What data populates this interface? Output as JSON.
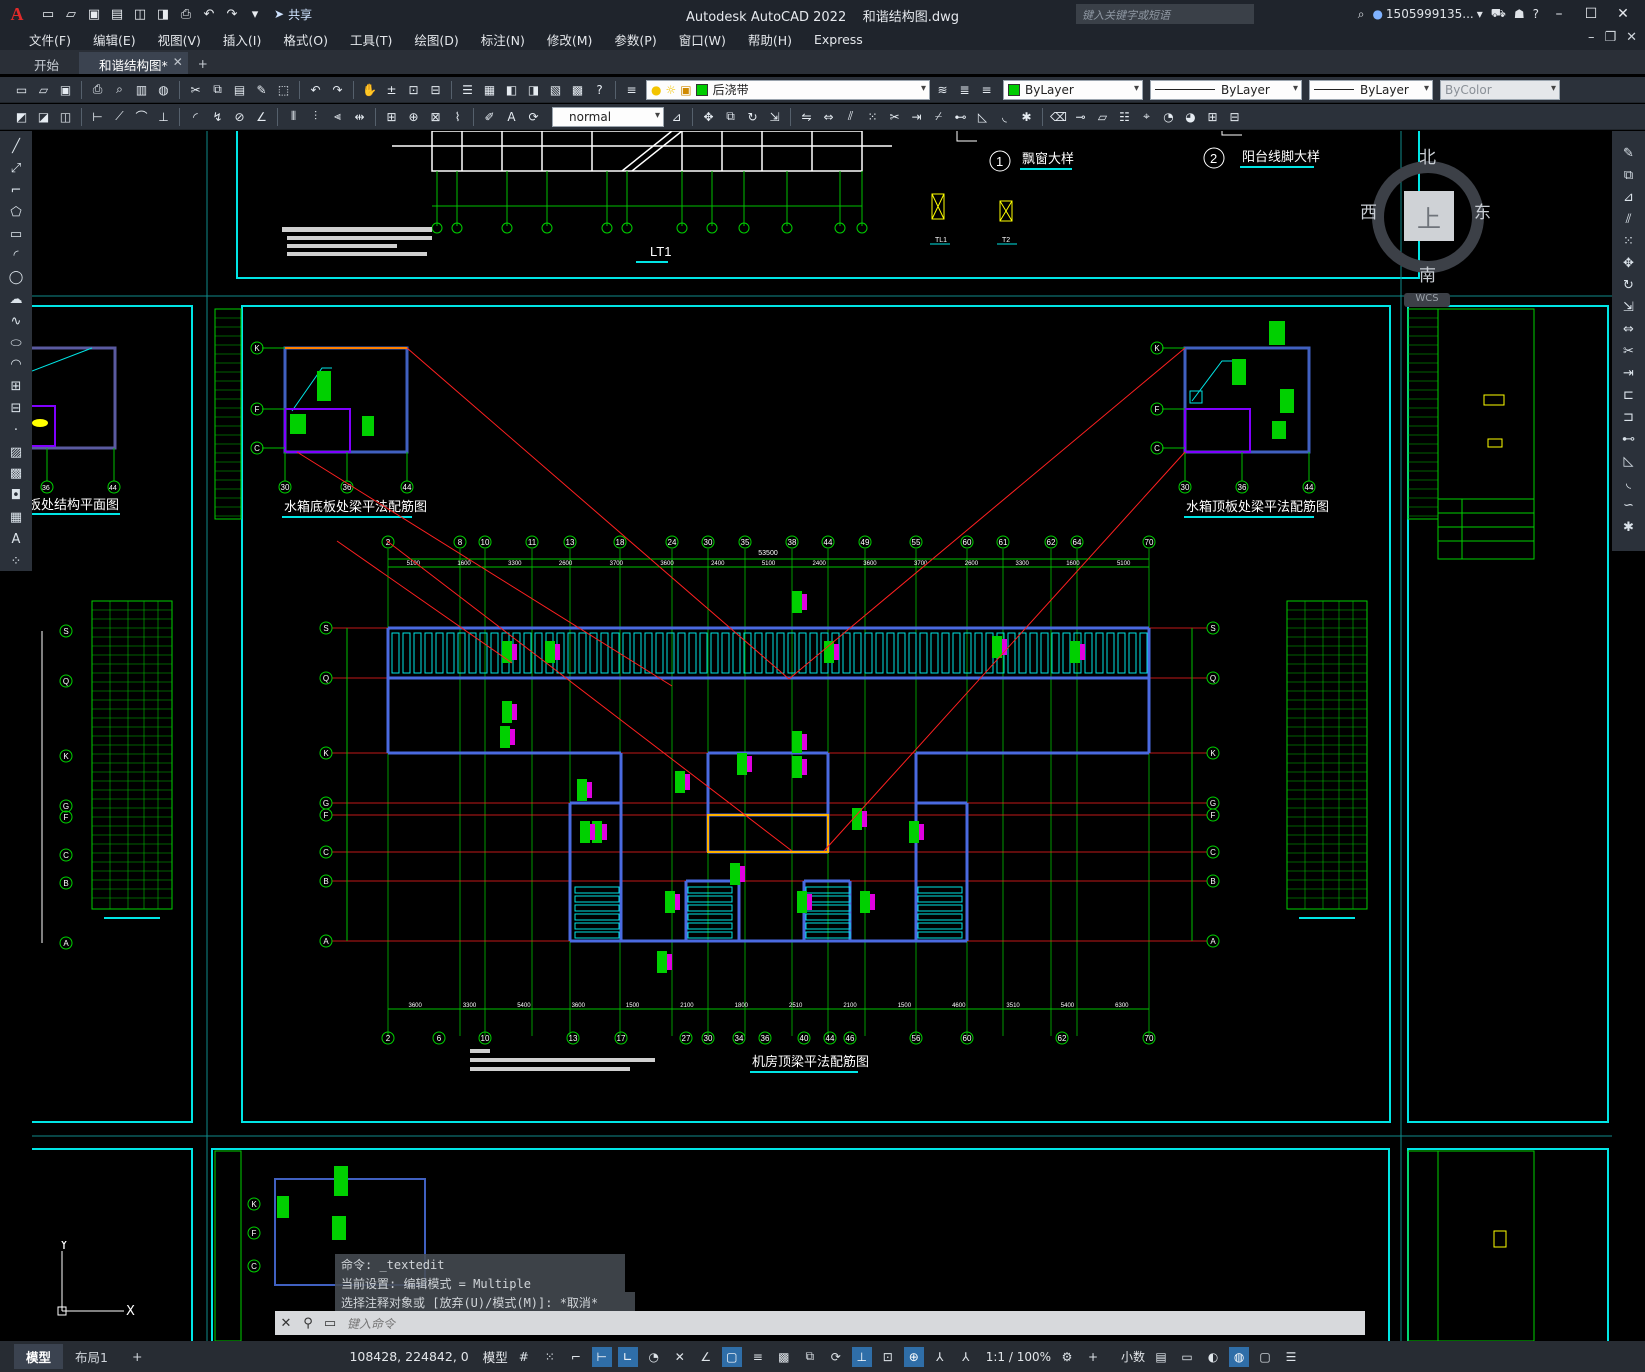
{
  "app": {
    "title": "Autodesk AutoCAD 2022",
    "file": "和谐结构图.dwg",
    "logo": "A",
    "share_label": "共享",
    "search_placeholder": "键入关键字或短语",
    "user": "1505999135...",
    "accent": "#00ffff"
  },
  "menus": [
    "文件(F)",
    "编辑(E)",
    "视图(V)",
    "插入(I)",
    "格式(O)",
    "工具(T)",
    "绘图(D)",
    "标注(N)",
    "修改(M)",
    "参数(P)",
    "窗口(W)",
    "帮助(H)",
    "Express"
  ],
  "tabs": {
    "start": "开始",
    "active": "和谐结构图*",
    "add": "+"
  },
  "toolbar1": {
    "layer_name": "后浇带",
    "layer_color": "#00cc00",
    "color_value": "ByLayer",
    "linetype_value": "ByLayer",
    "lineweight_value": "ByLayer",
    "plotstyle_value": "ByColor"
  },
  "toolbar2": {
    "text_style_value": "normal"
  },
  "viewcube": {
    "top": "上",
    "north": "北",
    "south": "南",
    "east": "东",
    "west": "西",
    "wcs": "WCS"
  },
  "drawing": {
    "label_lt1": "LT1",
    "label_window": "飘窗大样",
    "label_balcony": "阳台线脚大样",
    "circle1": "1",
    "circle2": "2",
    "label_left_plan": "板处结构平面图",
    "label_tank_bottom": "水箱底板处梁平法配筋图",
    "label_tank_top": "水箱顶板处梁平法配筋图",
    "label_machine_room": "机房顶梁平法配筋图",
    "label_tl1": "TL1",
    "label_t2": "T2",
    "top_axes": [
      "2",
      "8",
      "10",
      "11",
      "13",
      "18",
      "24",
      "30",
      "35",
      "38",
      "44",
      "49",
      "55",
      "60",
      "61",
      "62",
      "64",
      "70"
    ],
    "bottom_axes": [
      "2",
      "6",
      "10",
      "13",
      "17",
      "27",
      "30",
      "34",
      "36",
      "40",
      "44",
      "46",
      "56",
      "60",
      "62",
      "70"
    ],
    "row_axes": [
      "S",
      "Q",
      "K",
      "G",
      "F",
      "C",
      "B",
      "A"
    ],
    "top_dims": [
      "5100",
      "1600",
      "3300",
      "2600",
      "3700",
      "3600",
      "2400",
      "5100",
      "2400",
      "3600",
      "3700",
      "2600",
      "3300",
      "1600",
      "5100"
    ],
    "bottom_dims": [
      "3600",
      "3300",
      "5400",
      "3600",
      "1500",
      "2100",
      "1800",
      "2510",
      "2100",
      "1500",
      "4600",
      "3510",
      "5400",
      "6300"
    ],
    "total_dim": "53500",
    "tank_axes_left": [
      "30",
      "36",
      "44"
    ],
    "tank_axes_right": [
      "30",
      "36",
      "44"
    ],
    "tank_rows": [
      "K",
      "F",
      "C"
    ],
    "left_plan_axes": [
      "36",
      "44"
    ]
  },
  "command": {
    "history1": "命令: _textedit",
    "history2": "当前设置: 编辑模式 = Multiple",
    "history3": "选择注释对象或 [放弃(U)/模式(M)]: *取消*",
    "prompt": "键入命令"
  },
  "status": {
    "tab_model": "模型",
    "tab_layout": "布局1",
    "tab_add": "+",
    "coords": "108428, 224842, 0",
    "space": "模型",
    "scale": "1:1 / 100%",
    "units": "小数"
  },
  "ucs": {
    "x": "X",
    "y": "Y"
  }
}
